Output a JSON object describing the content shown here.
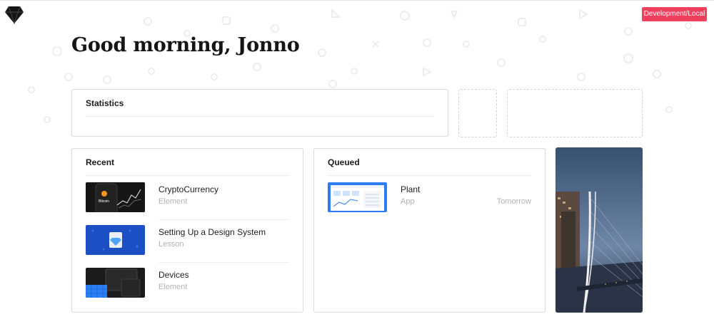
{
  "header": {
    "greeting": "Good morning, Jonno",
    "environment_badge": "Development/Local",
    "logo_icon": "sketch-diamond-icon"
  },
  "statistics": {
    "title": "Statistics"
  },
  "recent": {
    "title": "Recent",
    "items": [
      {
        "title": "CryptoCurrency",
        "type": "Element",
        "thumb_label": "Bitcoin"
      },
      {
        "title": "Setting Up a Design System",
        "type": "Lesson"
      },
      {
        "title": "Devices",
        "type": "Element"
      }
    ]
  },
  "queued": {
    "title": "Queued",
    "items": [
      {
        "title": "Plant",
        "type": "App",
        "when": "Tomorrow"
      }
    ]
  },
  "colors": {
    "badge": "#f0405d",
    "card_border": "#dcdcdc",
    "muted_text": "#b3b3b3"
  }
}
